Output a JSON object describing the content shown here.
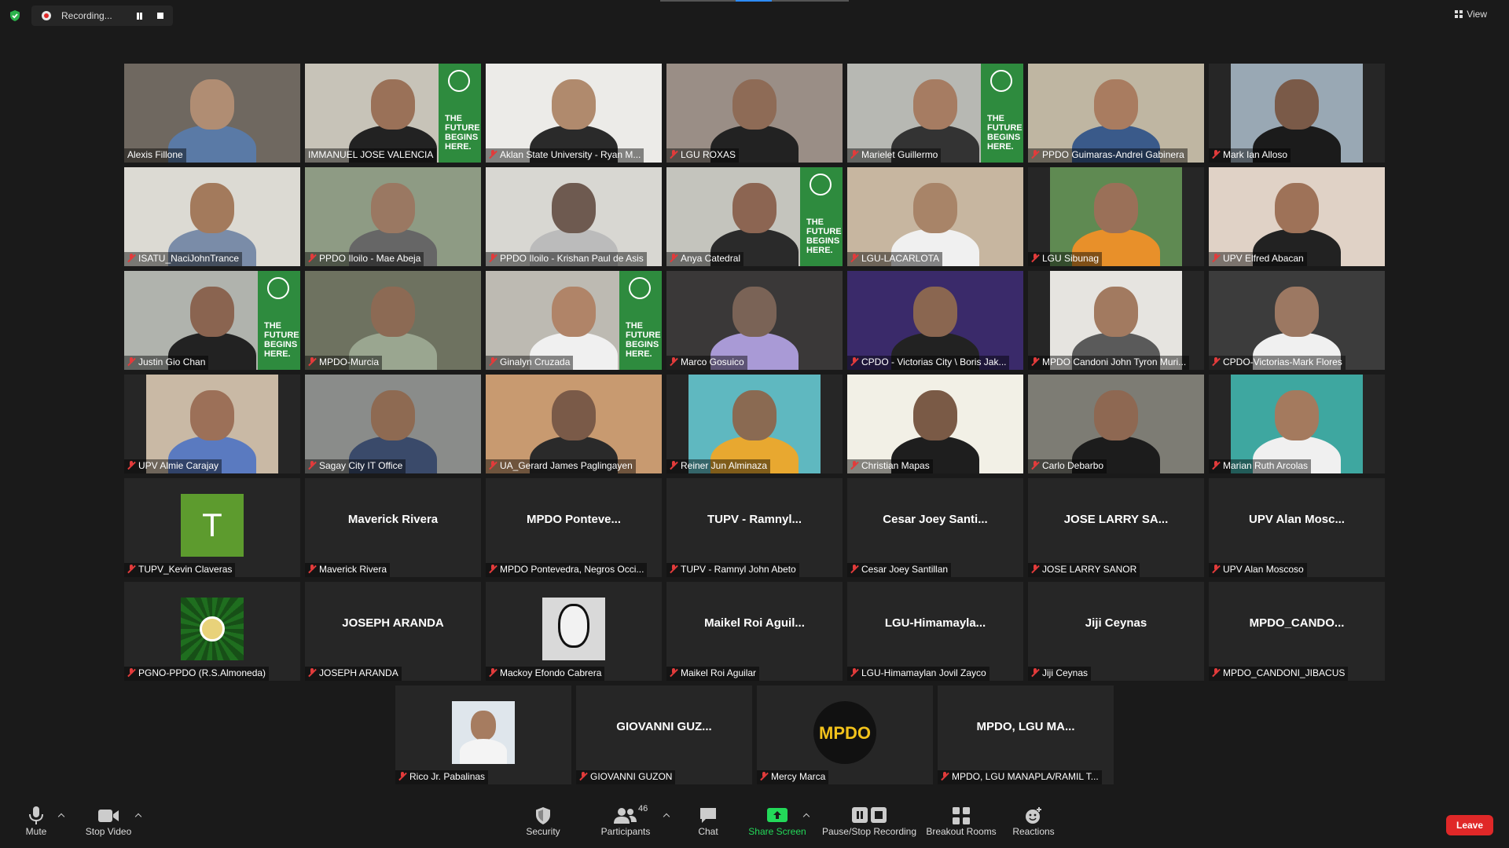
{
  "recording": {
    "label": "Recording..."
  },
  "view": {
    "label": "View"
  },
  "tiles": [
    {
      "name": "Alexis Fillone",
      "kind": "video",
      "bg": "#6f6860",
      "skin": "#b08d73",
      "shirt": "#5a7aa6",
      "accent": "#c83030"
    },
    {
      "name": "IMMANUEL JOSE VALENCIA",
      "kind": "video",
      "bg": "#c7c3b8",
      "skin": "#9a7158",
      "shirt": "#222",
      "banner": true,
      "active": true,
      "muted": false
    },
    {
      "name": "Aklan State University - Ryan M...",
      "kind": "video",
      "bg": "#ecebe8",
      "skin": "#b08a6d",
      "shirt": "#2a2a2a",
      "muted": true
    },
    {
      "name": "LGU ROXAS",
      "kind": "video",
      "bg": "#9a8e86",
      "skin": "#8e6b56",
      "shirt": "#222",
      "muted": true
    },
    {
      "name": "Marielet Guillermo",
      "kind": "video",
      "bg": "#b7b8b3",
      "skin": "#a67c62",
      "shirt": "#333",
      "banner": true,
      "muted": true
    },
    {
      "name": "PPDO Guimaras-Andrei Gabinera",
      "kind": "video",
      "bg": "#bfb6a2",
      "skin": "#a97c60",
      "shirt": "#3a5a8a",
      "muted": true
    },
    {
      "name": "Mark Ian Alloso",
      "kind": "video",
      "narrow": true,
      "bg": "#99a8b4",
      "skin": "#7a5a48",
      "shirt": "#1b1b1b",
      "muted": true
    },
    {
      "name": "ISATU_NaciJohnTrance",
      "kind": "video",
      "bg": "#dcdad3",
      "skin": "#a37a5c",
      "shirt": "#7a8ca8",
      "muted": true
    },
    {
      "name": "PPDO Iloilo - Mae Abeja",
      "kind": "video",
      "bg": "#8e9b84",
      "skin": "#9a7862",
      "shirt": "#666",
      "muted": true
    },
    {
      "name": "PPDO Iloilo - Krishan Paul de Asis",
      "kind": "video",
      "bg": "#d8d7d2",
      "skin": "#6e5a50",
      "shirt": "#bbb",
      "muted": true
    },
    {
      "name": "Anya Catedral",
      "kind": "video",
      "bg": "#c4c4bd",
      "skin": "#8c6552",
      "shirt": "#2a2a2a",
      "banner": true,
      "muted": true
    },
    {
      "name": "LGU-LACARLOTA",
      "kind": "video",
      "bg": "#c7b6a0",
      "skin": "#a88468",
      "shirt": "#f0f0f0",
      "muted": true
    },
    {
      "name": "LGU Sibunag",
      "kind": "video",
      "narrow": true,
      "bg": "#5f8a52",
      "skin": "#9a7058",
      "shirt": "#e8902a",
      "muted": true
    },
    {
      "name": "UPV Elfred Abacan",
      "kind": "video",
      "bg": "#e0d2c6",
      "skin": "#9e7258",
      "shirt": "#222",
      "muted": true
    },
    {
      "name": "Justin Gio Chan",
      "kind": "video",
      "bg": "#b0b3ad",
      "skin": "#8a6450",
      "shirt": "#222",
      "banner": true,
      "muted": true
    },
    {
      "name": "MPDO-Murcia",
      "kind": "video",
      "bg": "#6e7260",
      "skin": "#8c6a54",
      "shirt": "#9aa690",
      "muted": true
    },
    {
      "name": "Ginalyn Cruzada",
      "kind": "video",
      "bg": "#bdbab2",
      "skin": "#b08468",
      "shirt": "#f0f0f0",
      "banner": true,
      "muted": true
    },
    {
      "name": "Marco Gosuico",
      "kind": "video",
      "bg": "#3a3838",
      "skin": "#7a6356",
      "shirt": "#a99ad6",
      "muted": true
    },
    {
      "name": "CPDO - Victorias City \\ Boris Jak...",
      "kind": "video",
      "bg": "#3a2a6a",
      "skin": "#8a6650",
      "shirt": "#222",
      "muted": true
    },
    {
      "name": "MPDO Candoni John Tyron Muri...",
      "kind": "video",
      "narrow": true,
      "bg": "#e6e4e0",
      "skin": "#a27a60",
      "shirt": "#5a5a5a",
      "muted": true
    },
    {
      "name": "CPDO-Victorias-Mark Flores",
      "kind": "video",
      "bg": "#3c3c3c",
      "skin": "#9c7862",
      "shirt": "#f0f0f0",
      "muted": true
    },
    {
      "name": "UPV Almie Carajay",
      "kind": "video",
      "narrow": true,
      "bg": "#c9b9a5",
      "skin": "#9c7058",
      "shirt": "#5a7ac0",
      "muted": true
    },
    {
      "name": "Sagay City IT Office",
      "kind": "video",
      "bg": "#8a8c8a",
      "skin": "#8e6a52",
      "shirt": "#3a4a6a",
      "muted": true
    },
    {
      "name": "UA_Gerard James Paglingayen",
      "kind": "video",
      "bg": "#c89a70",
      "skin": "#7a5a48",
      "shirt": "#2a2a2a",
      "muted": true
    },
    {
      "name": "Reiner Jun Alminaza",
      "kind": "video",
      "narrow": true,
      "bg": "#5fb8c0",
      "skin": "#8a6a52",
      "shirt": "#e8a830",
      "muted": true
    },
    {
      "name": "Christian Mapas",
      "kind": "video",
      "bg": "#f2f0e6",
      "skin": "#7a5a46",
      "shirt": "#1e1e1e",
      "muted": true
    },
    {
      "name": "Carlo Debarbo",
      "kind": "video",
      "bg": "#7d7c74",
      "skin": "#8e6852",
      "shirt": "#1c1c1c",
      "muted": true
    },
    {
      "name": "Marian Ruth Arcolas",
      "kind": "video",
      "narrow": true,
      "bg": "#3ea7a0",
      "skin": "#a47a5e",
      "shirt": "#f0f0f0",
      "muted": true
    },
    {
      "name": "TUPV_Kevin Claveras",
      "kind": "letter",
      "letter": "T",
      "muted": true
    },
    {
      "name": "Maverick Rivera",
      "kind": "text",
      "big": "Maverick Rivera",
      "muted": true
    },
    {
      "name": "MPDO Pontevedra, Negros Occi...",
      "kind": "text",
      "big": "MPDO  Ponteve...",
      "muted": true
    },
    {
      "name": "TUPV - Ramnyl John Abeto",
      "kind": "text",
      "big": "TUPV - Ramnyl...",
      "muted": true
    },
    {
      "name": "Cesar Joey Santillan",
      "kind": "text",
      "big": "Cesar Joey Santi...",
      "muted": true
    },
    {
      "name": "JOSE LARRY SANOR",
      "kind": "text",
      "big": "JOSE LARRY SA...",
      "muted": true
    },
    {
      "name": "UPV Alan Moscoso",
      "kind": "text",
      "big": "UPV Alan Mosc...",
      "muted": true
    },
    {
      "name": "PGNO-PPDO (R.S.Almoneda)",
      "kind": "logo",
      "logo": "seal",
      "muted": true
    },
    {
      "name": "JOSEPH ARANDA",
      "kind": "text",
      "big": "JOSEPH ARANDA",
      "muted": true
    },
    {
      "name": "Mackoy Efondo Cabrera",
      "kind": "logo",
      "logo": "mask",
      "muted": true
    },
    {
      "name": "Maikel Roi Aguilar",
      "kind": "text",
      "big": "Maikel Roi Aguil...",
      "muted": true
    },
    {
      "name": "LGU-Himamaylan Jovil Zayco",
      "kind": "text",
      "big": "LGU-Himamayla...",
      "muted": true
    },
    {
      "name": "Jiji Ceynas",
      "kind": "text",
      "big": "Jiji Ceynas",
      "muted": true
    },
    {
      "name": "MPDO_CANDONI_JIBACUS",
      "kind": "text",
      "big": "MPDO_CANDO...",
      "muted": true
    },
    {
      "name": "Rico Jr. Pabalinas",
      "kind": "logo",
      "logo": "photo",
      "muted": true
    },
    {
      "name": "GIOVANNI GUZON",
      "kind": "text",
      "big": "GIOVANNI GUZ...",
      "muted": true
    },
    {
      "name": "Mercy Marca",
      "kind": "logo",
      "logo": "mpdo",
      "logoText": "MPDO",
      "muted": true
    },
    {
      "name": "MPDO, LGU MANAPLA/RAMIL T...",
      "kind": "text",
      "big": "MPDO, LGU MA...",
      "muted": true
    }
  ],
  "tile_labels": {
    "christian_logo": "MPDO"
  },
  "toolbar": {
    "mute": "Mute",
    "stop_video": "Stop Video",
    "security": "Security",
    "participants": "Participants",
    "participants_count": "46",
    "chat": "Chat",
    "share_screen": "Share Screen",
    "pause_stop_recording": "Pause/Stop Recording",
    "breakout_rooms": "Breakout Rooms",
    "reactions": "Reactions",
    "leave": "Leave"
  },
  "colors": {
    "accent_green": "#2e8b3e",
    "active_speaker": "#c7d34b",
    "leave_red": "#e02828",
    "share_green": "#23d959"
  }
}
